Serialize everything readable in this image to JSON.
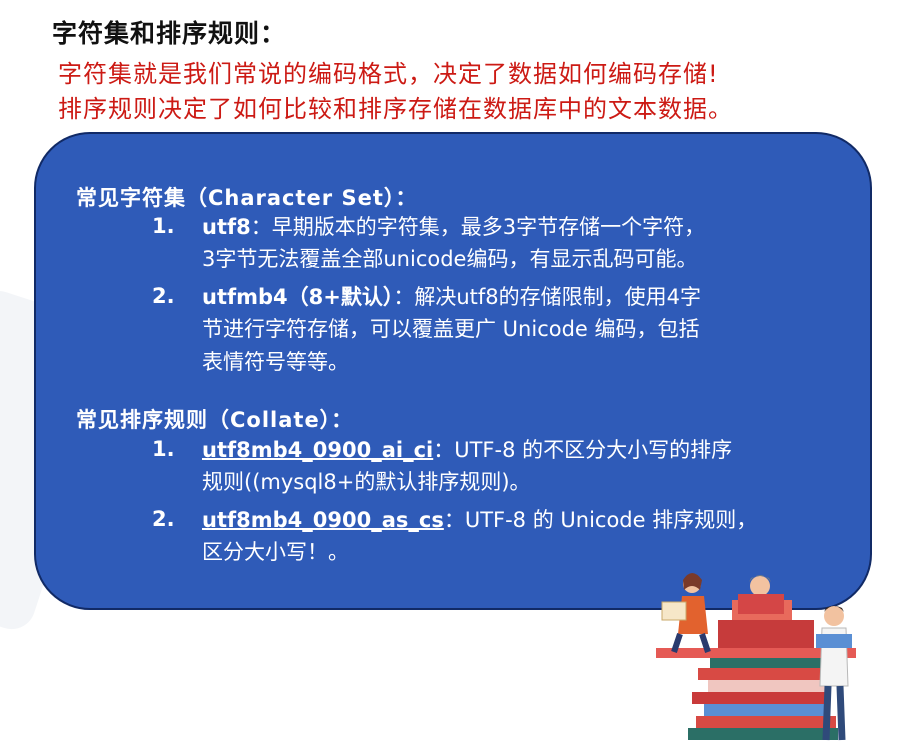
{
  "title": "字符集和排序规则：",
  "intro": {
    "line1": "字符集就是我们常说的编码格式，决定了数据如何编码存储!",
    "line2": "排序规则决定了如何比较和排序存储在数据库中的文本数据。"
  },
  "charset": {
    "heading": "常见字符集（Character Set）：",
    "items": [
      {
        "num": "1.",
        "name": "utf8",
        "line1_rest": "：早期版本的字符集，最多3字节存储一个字符，",
        "line2": "3字节无法覆盖全部unicode编码，有显示乱码可能。"
      },
      {
        "num": "2.",
        "name": "utfmb4（8+默认）",
        "line1_rest": "：解决utf8的存储限制，使用4字",
        "line2": "节进行字符存储，可以覆盖更广 Unicode 编码，包括",
        "line3": "表情符号等等。"
      }
    ]
  },
  "collate": {
    "heading": "常见排序规则（Collate）：",
    "items": [
      {
        "num": "1.",
        "name": "utf8mb4_0900_ai_ci",
        "line1_rest": "：UTF-8 的不区分大小写的排序",
        "line2": "规则((mysql8+的默认排序规则)。"
      },
      {
        "num": "2.",
        "name": "utf8mb4_0900_as_cs",
        "line1_rest": "：UTF-8 的 Unicode 排序规则，",
        "line2": "区分大小写！。"
      }
    ]
  },
  "colors": {
    "card_fill": "#2f5bb8",
    "intro_text": "#cc1a14",
    "title_text": "#111111"
  },
  "illustration": {
    "icon": "reading-people-books-illustration"
  }
}
